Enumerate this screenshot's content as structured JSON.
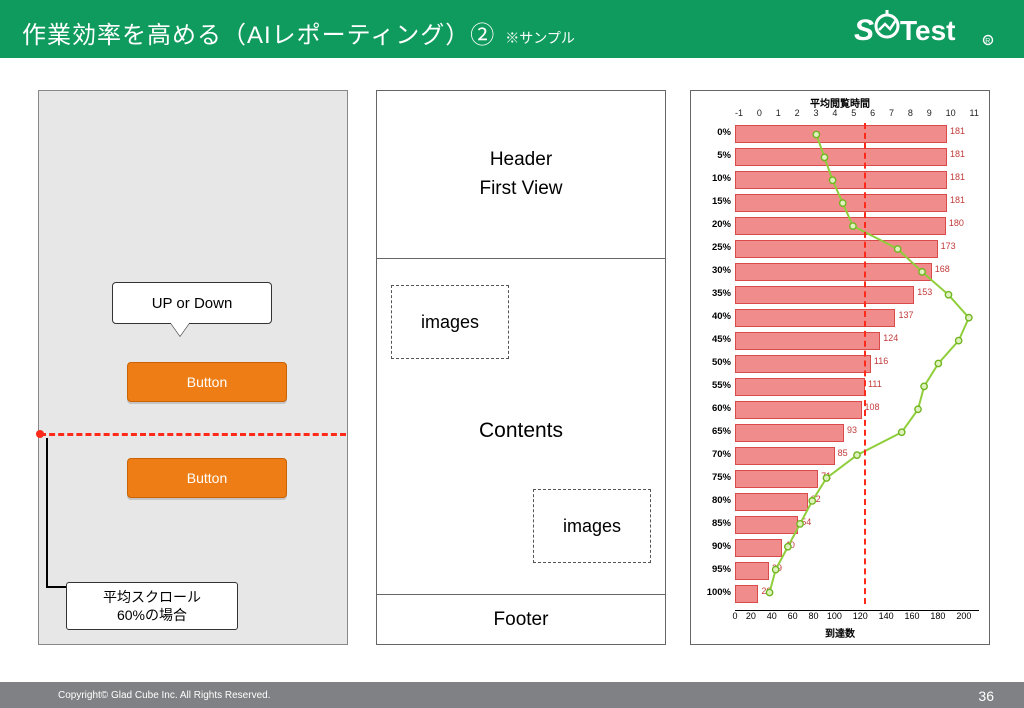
{
  "header": {
    "title": "作業効率を高める（AIレポーティング）②",
    "sub": "※サンプル",
    "logo_text": "SiTest"
  },
  "panel1": {
    "callout": "UP or Down",
    "button1": "Button",
    "button2": "Button",
    "scroll_label": "平均スクロール\n60%の場合"
  },
  "panel2": {
    "header": "Header\nFirst View",
    "images": "images",
    "contents": "Contents",
    "footer": "Footer"
  },
  "chart_data": {
    "type": "bar",
    "title_top": "平均閲覧時間",
    "xlabel": "到達数",
    "top_axis": [
      "-1",
      "0",
      "1",
      "2",
      "3",
      "4",
      "5",
      "6",
      "7",
      "8",
      "9",
      "10",
      "11"
    ],
    "categories": [
      "0%",
      "5%",
      "10%",
      "15%",
      "20%",
      "25%",
      "30%",
      "35%",
      "40%",
      "45%",
      "50%",
      "55%",
      "60%",
      "65%",
      "70%",
      "75%",
      "80%",
      "85%",
      "90%",
      "95%",
      "100%"
    ],
    "values": [
      181,
      181,
      181,
      181,
      180,
      173,
      168,
      153,
      137,
      124,
      116,
      111,
      108,
      93,
      85,
      71,
      62,
      54,
      40,
      29,
      20
    ],
    "line_top_scale": [
      3.0,
      3.4,
      3.8,
      4.3,
      4.8,
      7.0,
      8.2,
      9.5,
      10.5,
      10.0,
      9.0,
      8.3,
      8.0,
      7.2,
      5.0,
      3.5,
      2.8,
      2.2,
      1.6,
      1.0,
      0.7
    ],
    "xlim": [
      0,
      210
    ],
    "bottom_ticks": [
      0,
      20,
      40,
      60,
      80,
      100,
      120,
      140,
      160,
      180,
      200
    ],
    "vline_at": 110
  },
  "footer": {
    "copyright": "Copyright© Glad Cube Inc. All Rights Reserved.",
    "page": "36"
  }
}
